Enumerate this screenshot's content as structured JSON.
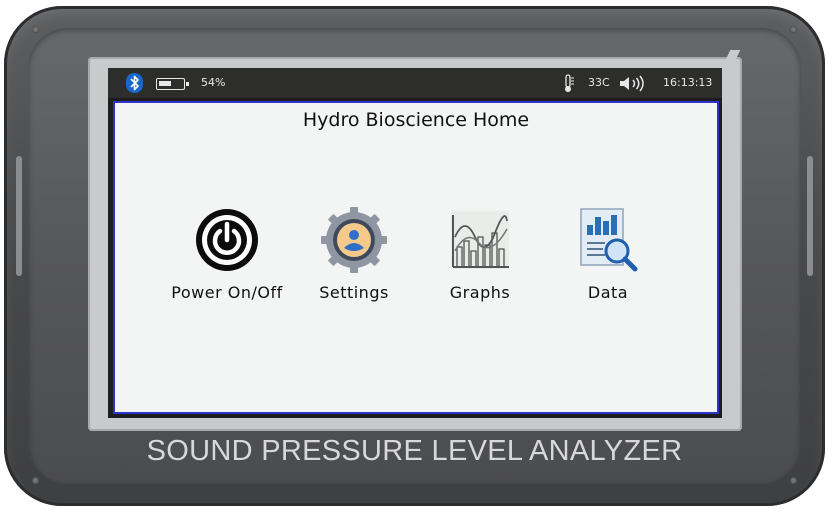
{
  "status_bar": {
    "battery_percent": "54%",
    "battery_level": 0.54,
    "temperature": "33C",
    "time": "16:13:13",
    "icons": [
      "bluetooth-icon",
      "battery-icon",
      "thermometer-icon",
      "speaker-icon"
    ]
  },
  "home": {
    "title": "Hydro Bioscience Home",
    "apps": [
      {
        "label": "Power On/Off",
        "icon": "power-icon"
      },
      {
        "label": "Settings",
        "icon": "settings-gear-icon"
      },
      {
        "label": "Graphs",
        "icon": "graphs-icon"
      },
      {
        "label": "Data",
        "icon": "data-search-icon"
      }
    ]
  },
  "device": {
    "label": "SOUND PRESSURE LEVEL ANALYZER"
  },
  "colors": {
    "screen_border": "#2e33c9",
    "bluetooth": "#1a67c8",
    "status_bar": "#2d2d2b",
    "content_bg": "#f2f5f3"
  }
}
